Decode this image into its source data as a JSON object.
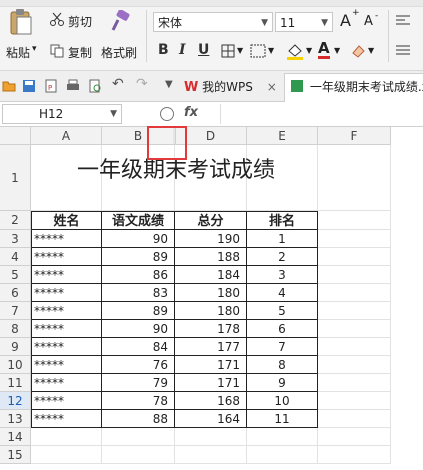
{
  "ribbon": {
    "paste_label": "粘贴",
    "cut_label": "剪切",
    "copy_label": "复制",
    "format_painter_label": "格式刷",
    "font_name": "宋体",
    "font_size": "11",
    "bold": "B",
    "italic": "I",
    "underline": "U",
    "grow_font": "A",
    "shrink_font": "A"
  },
  "tabs": {
    "wps_tab": "我的WPS",
    "doc_tab": "一年级期末考试成绩.x"
  },
  "formula_bar": {
    "name_box": "H12",
    "fx": "fx",
    "value": ""
  },
  "sheet": {
    "columns": [
      "A",
      "B",
      "D",
      "E",
      "F"
    ],
    "rows": [
      "1",
      "2",
      "3",
      "4",
      "5",
      "6",
      "7",
      "8",
      "9",
      "10",
      "11",
      "12",
      "13",
      "14",
      "15"
    ],
    "title": "一年级期末考试成绩",
    "headers": [
      "姓名",
      "语文成绩",
      "总分",
      "排名"
    ],
    "data": [
      [
        "*****",
        "90",
        "190",
        "1"
      ],
      [
        "*****",
        "89",
        "188",
        "2"
      ],
      [
        "*****",
        "86",
        "184",
        "3"
      ],
      [
        "*****",
        "83",
        "180",
        "4"
      ],
      [
        "*****",
        "89",
        "180",
        "5"
      ],
      [
        "*****",
        "90",
        "178",
        "6"
      ],
      [
        "*****",
        "84",
        "177",
        "7"
      ],
      [
        "*****",
        "76",
        "171",
        "8"
      ],
      [
        "*****",
        "79",
        "171",
        "9"
      ],
      [
        "*****",
        "78",
        "168",
        "10"
      ],
      [
        "*****",
        "88",
        "164",
        "11"
      ]
    ]
  },
  "colors": {
    "highlight": "#e23a3a",
    "wps_red": "#d62b2b",
    "grid_border": "#222222"
  }
}
